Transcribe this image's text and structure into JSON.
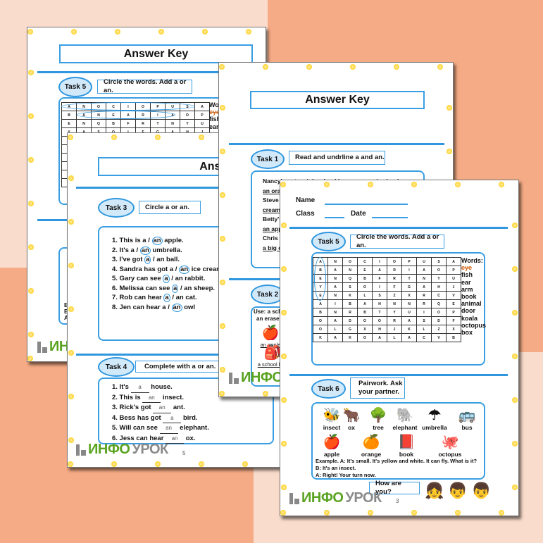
{
  "colors": {
    "background": "#f9dccb",
    "blob": "#f5ab85",
    "accent": "#2f97df",
    "pill": "#d2e9fa",
    "logo_green": "#5aa321"
  },
  "logo": {
    "part1": "ИНФО",
    "part2": "УРОК"
  },
  "page_back": {
    "title": "Answer Key",
    "task5": {
      "pill": "Task 5",
      "instruction": "Circle the words. Add a or an.",
      "words_label": "Wor",
      "words": [
        "eye",
        "fish",
        "ear",
        "arm"
      ]
    },
    "fragments": [
      "E",
      "B",
      "A"
    ]
  },
  "page_five": {
    "title": "Answer Key",
    "page_number": "5",
    "task3": {
      "pill": "Task 3",
      "instruction": "Circle a or an.",
      "items": [
        {
          "pre": "1. This is a / ",
          "c": "an",
          "post": " apple."
        },
        {
          "pre": "2. It's a / ",
          "c": "an",
          "post": " umbrella."
        },
        {
          "pre": "3. I've got ",
          "c": "a",
          "post": " / an ball."
        },
        {
          "pre": "4. Sandra has got a / ",
          "c": "an",
          "post": " ice cream."
        },
        {
          "pre": "5. Gary can see ",
          "c": "a",
          "post": " / an rabbit."
        },
        {
          "pre": "6. Melissa can see ",
          "c": "a",
          "post": " / an sheep."
        },
        {
          "pre": "7. Rob can hear ",
          "c": "a",
          "post": " / an cat."
        },
        {
          "pre": "8. Jen can hear a / ",
          "c": "an",
          "post": " owl"
        }
      ]
    },
    "task4": {
      "pill": "Task 4",
      "instruction": "Complete with a or an.",
      "items": [
        {
          "pre": "1. It's ",
          "b": "a",
          "post": " house."
        },
        {
          "pre": "2. This is ",
          "b": "an",
          "post": " insect."
        },
        {
          "pre": "3. Rick's got ",
          "b": "an",
          "post": " ant."
        },
        {
          "pre": "4. Bess has got ",
          "b": "a",
          "post": " bird."
        },
        {
          "pre": "5. Will can see ",
          "b": "an",
          "post": " elephant."
        },
        {
          "pre": "6. Jess can hear ",
          "b": "an",
          "post": " ox."
        }
      ]
    }
  },
  "page_mid": {
    "title": "Answer Key",
    "task1": {
      "pill": "Task 1",
      "instruction": "Read and undrline a and an.",
      "lines": [
        "Nancy's got a pink school bag, an exercise book",
        "an ora",
        "Steve",
        "cream",
        "Betty's",
        "an app",
        "Chris",
        "a big c"
      ]
    },
    "task2": {
      "pill": "Task 2",
      "use_line1": "Use: a scho",
      "use_line2": "an eraser,",
      "answers": [
        "an apple",
        "a school bag"
      ]
    }
  },
  "page_three": {
    "name_label": "Name",
    "class_label": "Class",
    "date_label": "Date",
    "page_number": "3",
    "task5": {
      "pill": "Task 5",
      "instruction": "Circle the words. Add a or an.",
      "words_label": "Words:",
      "words": [
        "eye",
        "fish",
        "ear",
        "arm",
        "book",
        "animal",
        "door",
        "koala",
        "octopus",
        "box"
      ],
      "grid": [
        [
          "A",
          "N",
          "O",
          "C",
          "I",
          "O",
          "P",
          "U",
          "S",
          "A"
        ],
        [
          "B",
          "A",
          "N",
          "E",
          "A",
          "R",
          "I",
          "A",
          "O",
          "P"
        ],
        [
          "E",
          "N",
          "Q",
          "B",
          "F",
          "R",
          "T",
          "N",
          "Y",
          "U"
        ],
        [
          "Y",
          "A",
          "S",
          "O",
          "I",
          "F",
          "G",
          "A",
          "H",
          "J"
        ],
        [
          "E",
          "N",
          "K",
          "L",
          "S",
          "Z",
          "X",
          "R",
          "C",
          "V"
        ],
        [
          "A",
          "I",
          "B",
          "A",
          "H",
          "N",
          "N",
          "R",
          "Q",
          "E"
        ],
        [
          "B",
          "N",
          "R",
          "B",
          "T",
          "Y",
          "U",
          "I",
          "O",
          "P"
        ],
        [
          "O",
          "A",
          "D",
          "O",
          "O",
          "R",
          "A",
          "S",
          "D",
          "F"
        ],
        [
          "O",
          "L",
          "G",
          "X",
          "H",
          "J",
          "K",
          "L",
          "Z",
          "X"
        ],
        [
          "K",
          "A",
          "K",
          "O",
          "A",
          "L",
          "A",
          "C",
          "V",
          "B"
        ]
      ]
    },
    "task6": {
      "pill": "Task 6",
      "instruction_line1": "Pairwork. Ask",
      "instruction_line2": "your partner.",
      "pictures": [
        {
          "label": "insect",
          "icon": "🐝"
        },
        {
          "label": "ox",
          "icon": "🐂"
        },
        {
          "label": "tree",
          "icon": "🌳"
        },
        {
          "label": "elephant",
          "icon": "🐘"
        },
        {
          "label": "umbrella",
          "icon": "☂"
        },
        {
          "label": "bus",
          "icon": "🚌"
        },
        {
          "label": "apple",
          "icon": "🍎"
        },
        {
          "label": "orange",
          "icon": "🍊"
        },
        {
          "label": "book",
          "icon": "📕"
        },
        {
          "label": "octopus",
          "icon": "🐙"
        }
      ],
      "example": [
        "Example. A: It's small. It's yellow and white. It can fly. What is it?",
        "B: It's an insect.",
        "A: Right! Your turn now."
      ]
    },
    "how_are_you": "How are you?"
  }
}
